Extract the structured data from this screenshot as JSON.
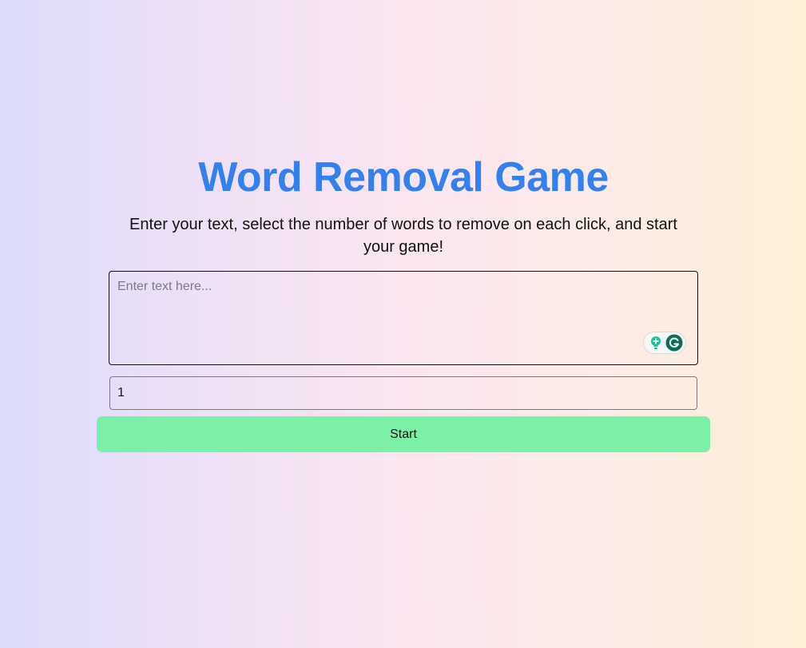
{
  "header": {
    "title": "Word Removal Game",
    "subtitle": "Enter your text, select the number of words to remove on each click, and start your game!"
  },
  "form": {
    "text_placeholder": "Enter text here...",
    "text_value": "",
    "words_to_remove_value": "1",
    "start_label": "Start"
  },
  "extension": {
    "icons": [
      "lightbulb-icon",
      "grammarly-g-icon"
    ]
  },
  "colors": {
    "title": "#3380f0",
    "start_button": "#7cf0a6",
    "grammarly_green": "#15c39a",
    "grammarly_dark": "#0b6e57"
  }
}
